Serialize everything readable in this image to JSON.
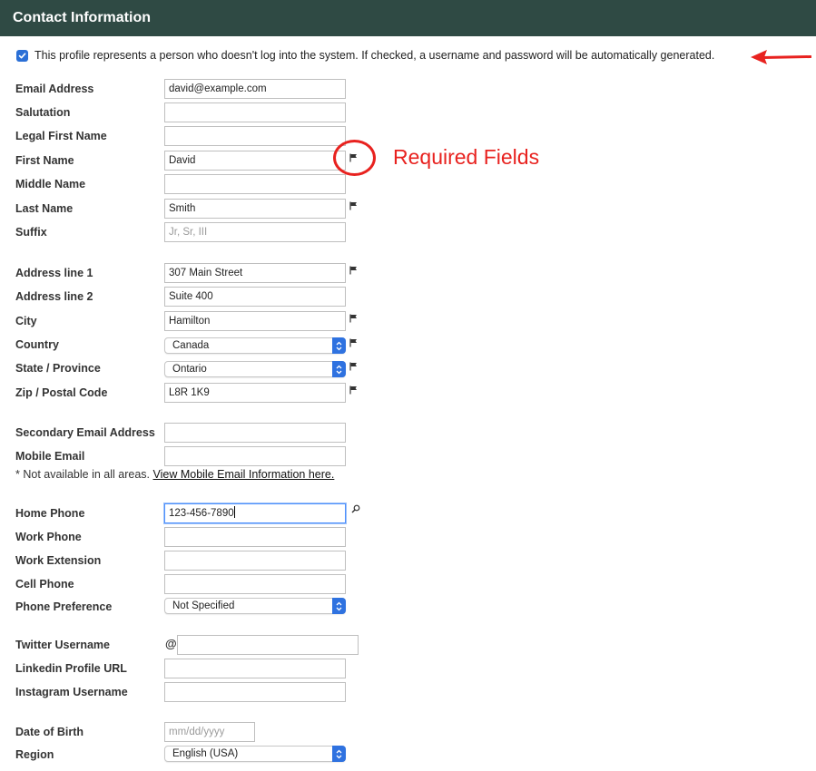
{
  "header": {
    "title": "Contact Information"
  },
  "notice": {
    "checked": true,
    "text": "This profile represents a person who doesn't log into the system. If checked, a username and password will be automatically generated."
  },
  "annotation": {
    "required_label": "Required Fields",
    "color": "#e8221f"
  },
  "fields": {
    "email": {
      "label": "Email Address",
      "value": "david@example.com"
    },
    "salutation": {
      "label": "Salutation",
      "value": ""
    },
    "legal_first_name": {
      "label": "Legal First Name",
      "value": ""
    },
    "first_name": {
      "label": "First Name",
      "value": "David",
      "required": true
    },
    "middle_name": {
      "label": "Middle Name",
      "value": ""
    },
    "last_name": {
      "label": "Last Name",
      "value": "Smith",
      "required": true
    },
    "suffix": {
      "label": "Suffix",
      "placeholder": "Jr, Sr, III"
    },
    "address1": {
      "label": "Address line 1",
      "value": "307 Main Street",
      "required": true
    },
    "address2": {
      "label": "Address line 2",
      "value": "Suite 400"
    },
    "city": {
      "label": "City",
      "value": "Hamilton",
      "required": true
    },
    "country": {
      "label": "Country",
      "value": "Canada",
      "required": true
    },
    "state": {
      "label": "State / Province",
      "value": "Ontario",
      "required": true
    },
    "zip": {
      "label": "Zip / Postal Code",
      "value": "L8R 1K9",
      "required": true
    },
    "secondary_email": {
      "label": "Secondary Email Address",
      "value": ""
    },
    "mobile_email": {
      "label": "Mobile Email",
      "value": ""
    },
    "mobile_note": {
      "text": "* Not available in all areas. ",
      "link": "View Mobile Email Information here."
    },
    "home_phone": {
      "label": "Home Phone",
      "value": "123-456-7890"
    },
    "work_phone": {
      "label": "Work Phone",
      "value": ""
    },
    "work_extension": {
      "label": "Work Extension",
      "value": ""
    },
    "cell_phone": {
      "label": "Cell Phone",
      "value": ""
    },
    "phone_preference": {
      "label": "Phone Preference",
      "value": "Not Specified"
    },
    "twitter": {
      "label": "Twitter Username",
      "prefix": "@",
      "value": ""
    },
    "linkedin": {
      "label": "Linkedin Profile URL",
      "value": ""
    },
    "instagram": {
      "label": "Instagram Username",
      "value": ""
    },
    "dob": {
      "label": "Date of Birth",
      "placeholder": "mm/dd/yyyy"
    },
    "region": {
      "label": "Region",
      "value": "English (USA)"
    }
  },
  "icons": {
    "flag": "flag-icon",
    "search": "magnifier-icon",
    "arrow": "red-arrow-icon"
  },
  "colors": {
    "header_bg": "#2f4a44",
    "select_accent": "#2f72e0",
    "checkbox": "#2a6fd6"
  }
}
